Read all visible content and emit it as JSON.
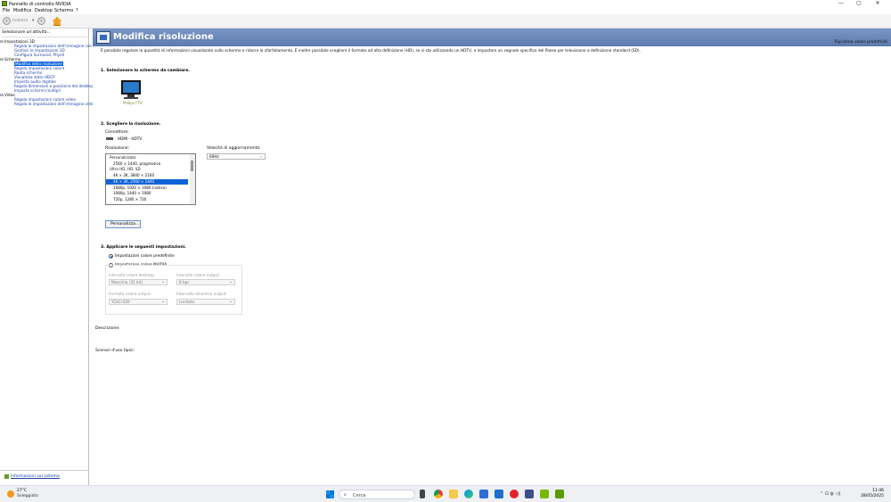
{
  "window": {
    "title": "Pannello di controllo NVIDIA",
    "min": "—",
    "max": "▢",
    "close": "✕"
  },
  "menu": [
    "File",
    "Modifica",
    "Desktop",
    "Schermo",
    "?"
  ],
  "toolbar": {
    "back_label": "Indietro"
  },
  "left": {
    "header": "Selezionare un'attività...",
    "tree": [
      {
        "label": "Impostazioni 3D",
        "type": "cat",
        "level": 0,
        "expander": "⊟"
      },
      {
        "label": "Regola le impostazioni dell'immagine con anteprima",
        "type": "lnk",
        "level": 1
      },
      {
        "label": "Gestisci le impostazioni 3D",
        "type": "lnk",
        "level": 1
      },
      {
        "label": "Configura Surround, PhysX",
        "type": "lnk",
        "level": 1
      },
      {
        "label": "Schermo",
        "type": "cat",
        "level": 0,
        "expander": "⊟"
      },
      {
        "label": "Modifica della risoluzione",
        "type": "sel",
        "level": 1
      },
      {
        "label": "Regola impostazioni colore",
        "type": "lnk",
        "level": 1
      },
      {
        "label": "Ruota schermo",
        "type": "lnk",
        "level": 1
      },
      {
        "label": "Visualizza stato HDCP",
        "type": "lnk",
        "level": 1
      },
      {
        "label": "Imposta audio digitale",
        "type": "lnk",
        "level": 1
      },
      {
        "label": "Regola dimensioni e posizione del desktop",
        "type": "lnk",
        "level": 1
      },
      {
        "label": "Imposta schermi multipli",
        "type": "lnk",
        "level": 1
      },
      {
        "label": "Video",
        "type": "cat",
        "level": 0,
        "expander": "⊟"
      },
      {
        "label": "Regola impostazioni colore video",
        "type": "lnk",
        "level": 1
      },
      {
        "label": "Regola le impostazioni dell'immagine video",
        "type": "lnk",
        "level": 1
      }
    ],
    "footer_link": "Informazioni sul sistema"
  },
  "banner": {
    "title": "Modifica risoluzione",
    "restore": "Ripristina valori predefiniti"
  },
  "main": {
    "description": "È possibile regolare la quantità di informazioni visualizzate sullo schermo e ridurre lo sfarfallamento. È inoltre possibile scegliere il formato ad alta definizione (HD), se si sta utilizzando un HDTV, e impostare un segnale specifico del Paese per televisione a definizione standard (SD).",
    "section1": "1. Selezionare lo schermo da cambiare.",
    "monitor_label": "Philips FTV",
    "section2": "2. Scegliere la risoluzione.",
    "connector_label": "Connettore:",
    "connector_value": "HDMI - HDTV",
    "resolution_label": "Risoluzione:",
    "resolutions": [
      {
        "label": "Personalizzato",
        "type": "grp"
      },
      {
        "label": "2560 × 1440, progressivo",
        "type": "item"
      },
      {
        "label": "Ultra HD, HD, SD",
        "type": "grp"
      },
      {
        "label": "4K × 2K, 3840 × 2160",
        "type": "item"
      },
      {
        "label": "4K × 2K, 2560 × 1440",
        "type": "sel"
      },
      {
        "label": "1080p, 1920 × 1080 (nativo)",
        "type": "item"
      },
      {
        "label": "1080p, 1440 × 1080",
        "type": "item"
      },
      {
        "label": "720p, 1280 × 720",
        "type": "item"
      }
    ],
    "refresh_label": "Velocità di aggiornamento:",
    "refresh_value": "60Hz",
    "customize_button": "Personalizza...",
    "section3": "3. Applicare le seguenti impostazioni.",
    "radio_default": "Impostazioni colore predefinite",
    "radio_nvidia": "Impostazioni colore NVIDIA",
    "desktop_depth_label": "Intensità colore desktop:",
    "desktop_depth_value": "Massima (32 bit)",
    "output_depth_label": "Intensità colore output:",
    "output_depth_value": "8 bpc",
    "output_format_label": "Formato colore output:",
    "output_format_value": "YCbCr420",
    "dynamic_range_label": "Intervallo dinamico output:",
    "dynamic_range_value": "Limitato",
    "descrizione_label": "Descrizione:",
    "scenari_label": "Scenari d'uso tipici:"
  },
  "taskbar": {
    "temp": "27°C",
    "condition": "Soleggiato",
    "search_placeholder": "Cerca",
    "search_icon": "⌕",
    "apps": [
      "file-explorer",
      "chrome",
      "edge",
      "store",
      "mail",
      "opera",
      "teams",
      "nvidia",
      "nvidia-settings"
    ],
    "tray": "⌃ ⊡ ◍ ◁)",
    "time": "11:46",
    "date": "28/05/2025"
  },
  "colors": {
    "banner": "#6f8bbd",
    "selection": "#0a64d8",
    "link": "#1b3fa8",
    "nvidia": "#76b900"
  }
}
